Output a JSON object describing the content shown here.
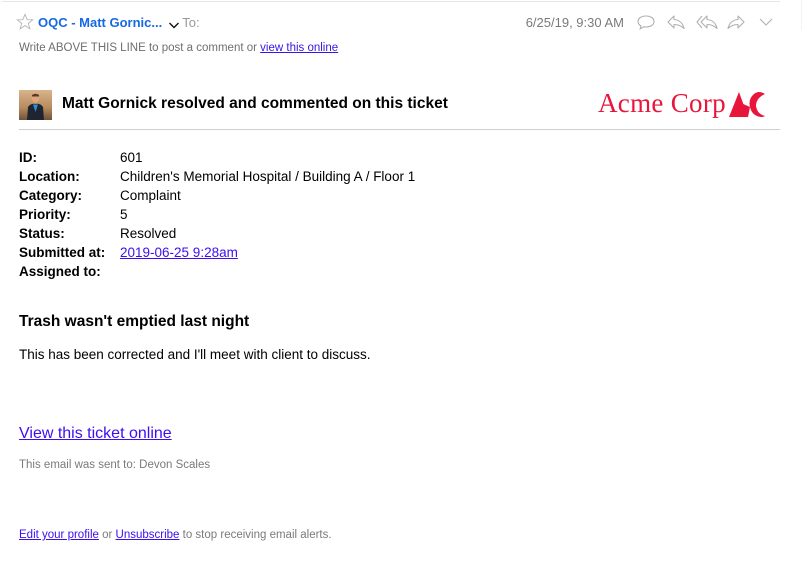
{
  "mail_header": {
    "from_label": "OQC - Matt Gornic...",
    "to_label": "To:",
    "date": "6/25/19, 9:30 AM",
    "icons": [
      "star-icon",
      "chevron-down-icon",
      "comment-icon",
      "reply-icon",
      "reply-all-icon",
      "forward-icon",
      "more-chevron-icon"
    ]
  },
  "reply_note": {
    "text": "Write ABOVE THIS LINE to post a comment or ",
    "link": "view this online"
  },
  "activity": {
    "headline": "Matt Gornick resolved and commented on this ticket"
  },
  "brand": {
    "name": "Acme Corp",
    "color": "#e8163a"
  },
  "ticket": {
    "fields": [
      {
        "label": "ID:",
        "value": "601"
      },
      {
        "label": "Location:",
        "value": "Children's Memorial Hospital / Building A / Floor 1"
      },
      {
        "label": "Category:",
        "value": "Complaint"
      },
      {
        "label": "Priority:",
        "value": "5"
      },
      {
        "label": "Status:",
        "value": "Resolved"
      },
      {
        "label": "Submitted at:",
        "value": "2019-06-25 9:28am"
      },
      {
        "label": "Assigned to:",
        "value": ""
      }
    ],
    "subject": "Trash wasn't emptied last night",
    "comment": "This has been corrected and I'll meet with client to discuss."
  },
  "links": {
    "view_ticket": "View this ticket online",
    "link_color": "#3c0ef0"
  },
  "footer": {
    "sent_to": "This email was sent to: Devon Scales",
    "edit_profile": "Edit your profile",
    "or": " or ",
    "unsubscribe": "Unsubscribe",
    "suffix": " to stop receiving email alerts."
  }
}
